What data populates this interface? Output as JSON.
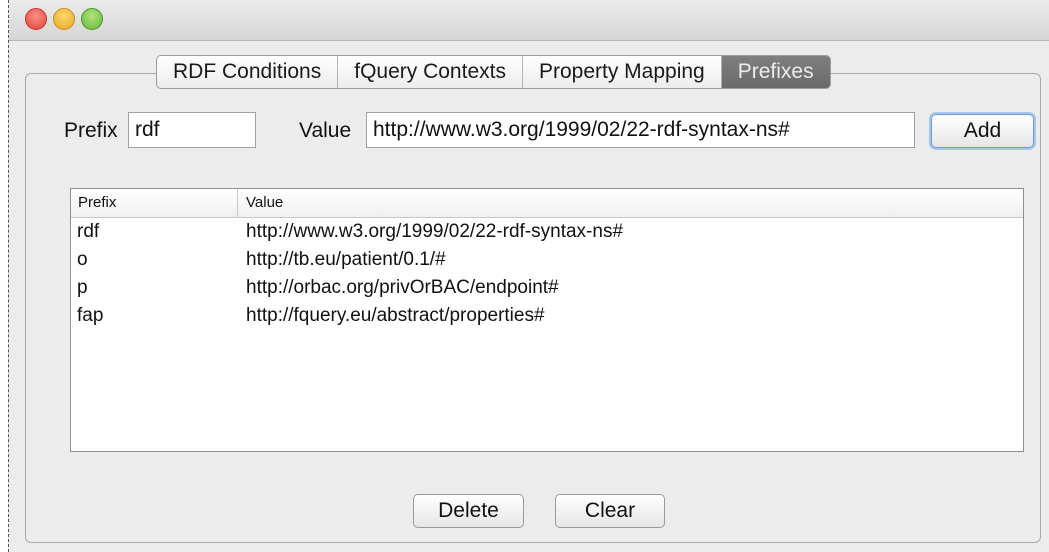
{
  "window": {
    "traffic_lights": [
      "close",
      "minimize",
      "zoom"
    ]
  },
  "tabs": [
    {
      "label": "RDF Conditions",
      "active": false
    },
    {
      "label": "fQuery Contexts",
      "active": false
    },
    {
      "label": "Property Mapping",
      "active": false
    },
    {
      "label": "Prefixes",
      "active": true
    }
  ],
  "form": {
    "prefix_label": "Prefix",
    "prefix_value": "rdf",
    "value_label": "Value",
    "value_value": "http://www.w3.org/1999/02/22-rdf-syntax-ns#",
    "add_label": "Add"
  },
  "table": {
    "columns": [
      "Prefix",
      "Value"
    ],
    "rows": [
      {
        "prefix": "rdf",
        "value": "http://www.w3.org/1999/02/22-rdf-syntax-ns#"
      },
      {
        "prefix": "o",
        "value": "http://tb.eu/patient/0.1/#"
      },
      {
        "prefix": "p",
        "value": "http://orbac.org/privOrBAC/endpoint#"
      },
      {
        "prefix": "fap",
        "value": "http://fquery.eu/abstract/properties#"
      }
    ]
  },
  "buttons": {
    "delete_label": "Delete",
    "clear_label": "Clear"
  }
}
